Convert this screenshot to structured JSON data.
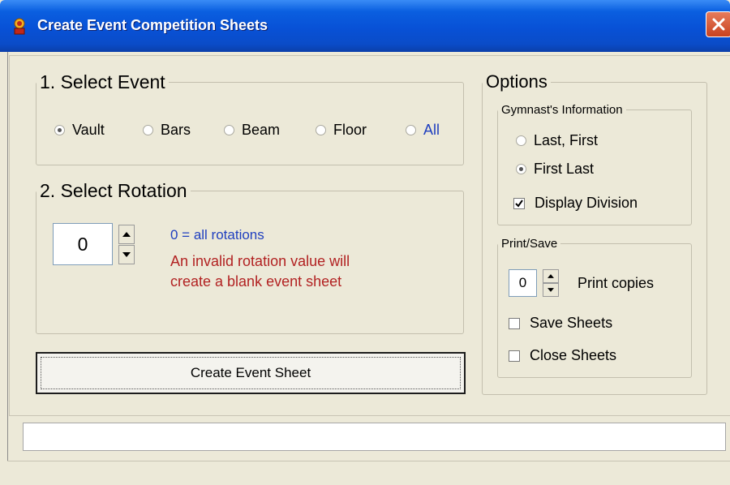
{
  "window": {
    "title": "Create Event Competition Sheets",
    "icon": "app-icon",
    "close_icon": "close-icon"
  },
  "select_event": {
    "legend": "1. Select Event",
    "options": [
      "Vault",
      "Bars",
      "Beam",
      "Floor",
      "All"
    ],
    "selected": "Vault",
    "all_color": "#1f3fbf"
  },
  "select_rotation": {
    "legend": "2. Select Rotation",
    "value": "0",
    "hint_blue": "0 = all rotations",
    "hint_red_line1": "An invalid rotation value will",
    "hint_red_line2": "create a blank event sheet",
    "blue_color": "#1f3fbf",
    "red_color": "#b22222"
  },
  "create_button": {
    "label": "Create Event Sheet"
  },
  "options": {
    "legend": "Options",
    "gymnast_info": {
      "legend": "Gymnast's Information",
      "choices": [
        "Last, First",
        "First Last"
      ],
      "selected": "First Last",
      "display_division": {
        "label": "Display Division",
        "checked": true
      }
    },
    "print_save": {
      "legend": "Print/Save",
      "copies_value": "0",
      "copies_label": "Print copies",
      "save_sheets": {
        "label": "Save Sheets",
        "checked": false
      },
      "close_sheets": {
        "label": "Close Sheets",
        "checked": false
      }
    }
  },
  "status_field": {
    "value": ""
  }
}
